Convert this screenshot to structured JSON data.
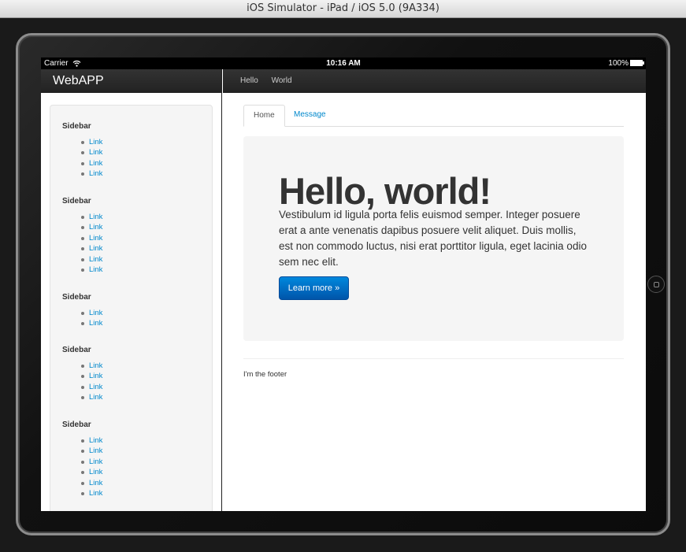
{
  "window": {
    "title": "iOS Simulator - iPad / iOS 5.0 (9A334)"
  },
  "statusbar": {
    "carrier": "Carrier",
    "wifi_icon": "wifi-icon",
    "time": "10:16 AM",
    "battery": "100%",
    "battery_icon": "battery-icon"
  },
  "left_nav": {
    "brand": "WebAPP"
  },
  "right_nav": {
    "items": [
      {
        "label": "Hello"
      },
      {
        "label": "World"
      }
    ]
  },
  "sidebar": {
    "sections": [
      {
        "header": "Sidebar",
        "links": [
          "Link",
          "Link",
          "Link",
          "Link"
        ]
      },
      {
        "header": "Sidebar",
        "links": [
          "Link",
          "Link",
          "Link",
          "Link",
          "Link",
          "Link"
        ]
      },
      {
        "header": "Sidebar",
        "links": [
          "Link",
          "Link"
        ]
      },
      {
        "header": "Sidebar",
        "links": [
          "Link",
          "Link",
          "Link",
          "Link"
        ]
      },
      {
        "header": "Sidebar",
        "links": [
          "Link",
          "Link",
          "Link",
          "Link",
          "Link",
          "Link"
        ]
      }
    ]
  },
  "tabs": [
    {
      "label": "Home",
      "active": true
    },
    {
      "label": "Message",
      "active": false
    }
  ],
  "hero": {
    "title": "Hello, world!",
    "text": "Vestibulum id ligula porta felis euismod semper. Integer posuere erat a ante venenatis dapibus posuere velit aliquet. Duis mollis, est non commodo luctus, nisi erat porttitor ligula, eget lacinia odio sem nec elit.",
    "button": "Learn more »"
  },
  "footer": {
    "text": "I'm the footer"
  },
  "colors": {
    "link": "#0088cc",
    "navbar": "#222222",
    "button": "#0066cc",
    "well": "#f5f5f5"
  }
}
